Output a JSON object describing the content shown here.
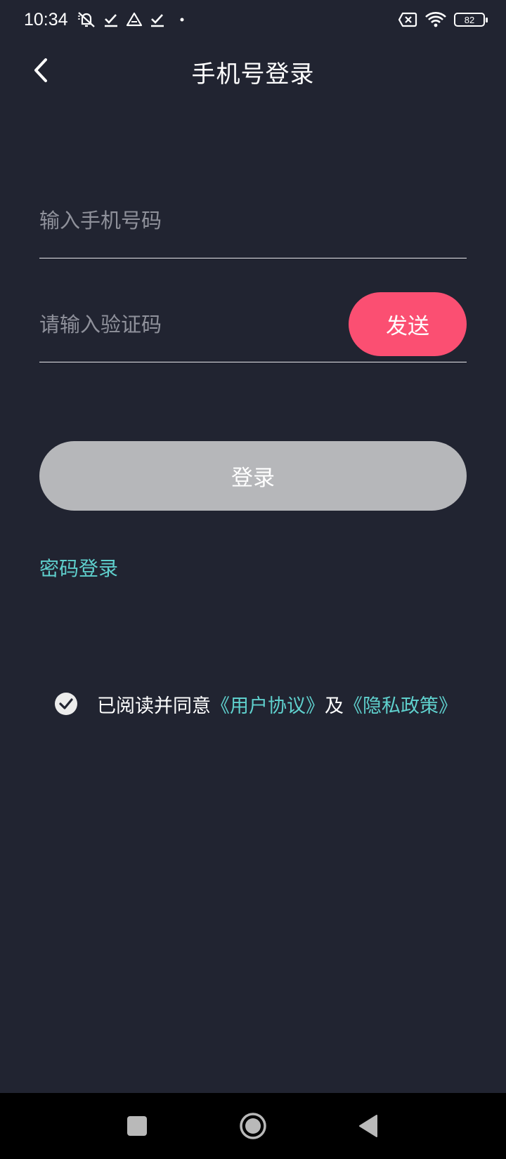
{
  "status_bar": {
    "time": "10:34",
    "battery_level": "82",
    "icons": [
      "mute-icon",
      "check-icon",
      "triangle-icon",
      "check-icon",
      "dot-icon",
      "sim-x-icon",
      "wifi-icon",
      "battery-icon"
    ]
  },
  "header": {
    "title": "手机号登录",
    "back_icon": "chevron-left-icon"
  },
  "form": {
    "phone_placeholder": "输入手机号码",
    "phone_value": "",
    "code_placeholder": "请输入验证码",
    "code_value": "",
    "send_label": "发送",
    "login_label": "登录",
    "password_login_label": "密码登录"
  },
  "agreement": {
    "checked": true,
    "text_prefix": "已阅读并同意",
    "user_agreement": "《用户协议》",
    "conjunction": "及",
    "privacy_policy": "《隐私政策》"
  },
  "colors": {
    "background": "#212431",
    "accent_pink": "#fb4f72",
    "link_teal": "#5fd0cd",
    "disabled_gray": "#b6b7ba"
  },
  "nav_bar": {
    "icons": [
      "recent-apps-icon",
      "home-icon",
      "back-triangle-icon"
    ]
  }
}
